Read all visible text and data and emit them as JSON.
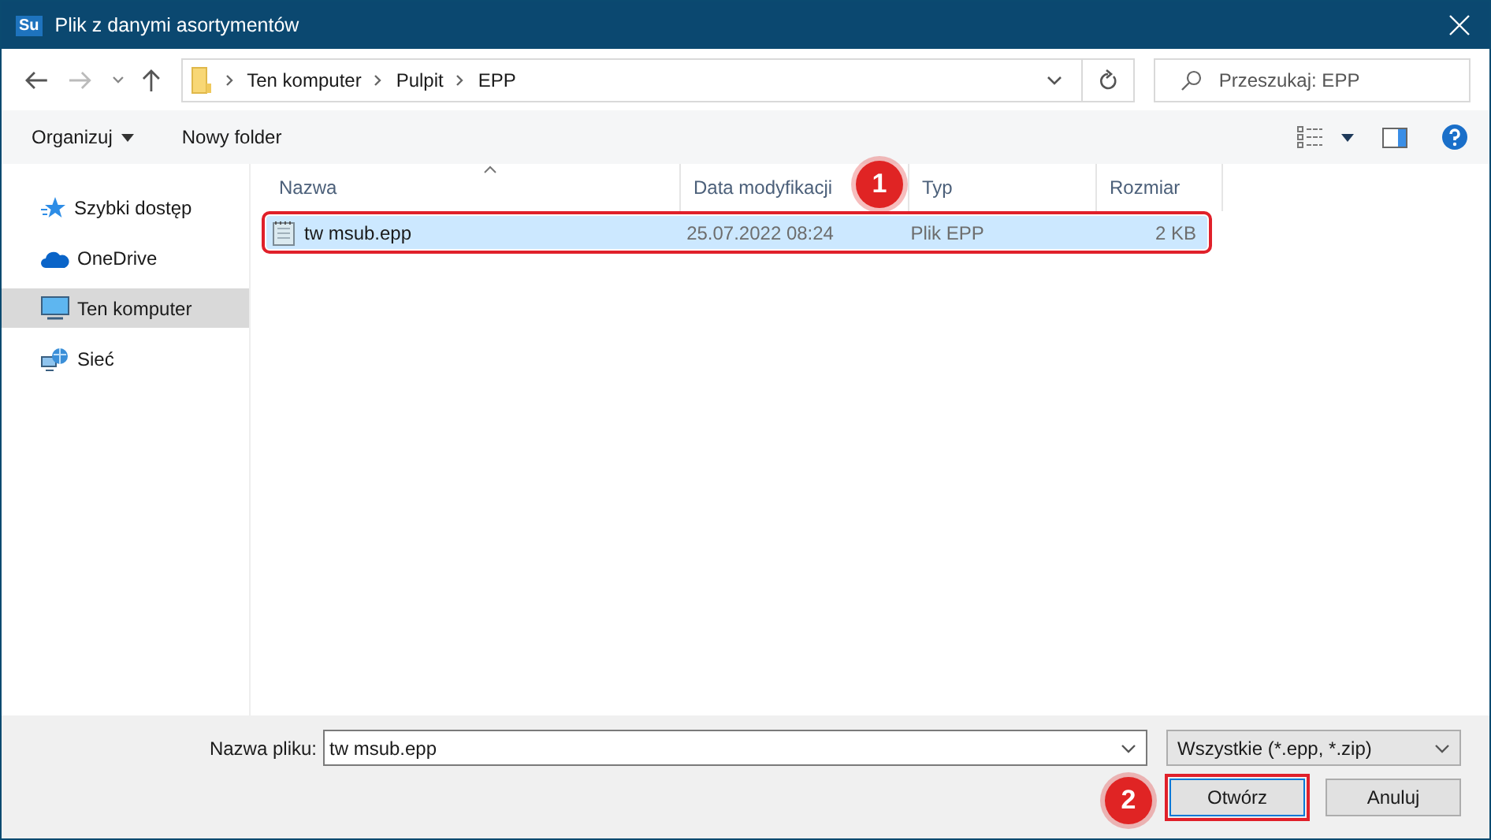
{
  "window": {
    "title": "Plik z danymi asortymentów",
    "app_icon": "Su"
  },
  "address_bar": {
    "path": [
      "Ten komputer",
      "Pulpit",
      "EPP"
    ]
  },
  "search": {
    "placeholder": "Przeszukaj: EPP"
  },
  "toolbar": {
    "organize": "Organizuj",
    "new_folder": "Nowy folder"
  },
  "sidebar": {
    "items": [
      {
        "label": "Szybki dostęp",
        "kind": "star",
        "selected": false
      },
      {
        "label": "OneDrive",
        "kind": "cloud",
        "selected": false
      },
      {
        "label": "Ten komputer",
        "kind": "computer",
        "selected": true
      },
      {
        "label": "Sieć",
        "kind": "network",
        "selected": false
      }
    ]
  },
  "table": {
    "columns": [
      "Nazwa",
      "Data modyfikacji",
      "Typ",
      "Rozmiar"
    ],
    "rows": [
      {
        "name": "tw msub.epp",
        "date": "25.07.2022 08:24",
        "type": "Plik EPP",
        "size": "2 KB",
        "selected": true,
        "highlighted": true
      }
    ]
  },
  "footer": {
    "filename_label": "Nazwa pliku:",
    "filename": "tw msub.epp",
    "filter": "Wszystkie (*.epp, *.zip)",
    "buttons": [
      {
        "label": "Otwórz",
        "highlighted": true
      },
      {
        "label": "Anuluj",
        "highlighted": false
      }
    ]
  },
  "annotations": [
    {
      "label": "1"
    },
    {
      "label": "2"
    }
  ]
}
